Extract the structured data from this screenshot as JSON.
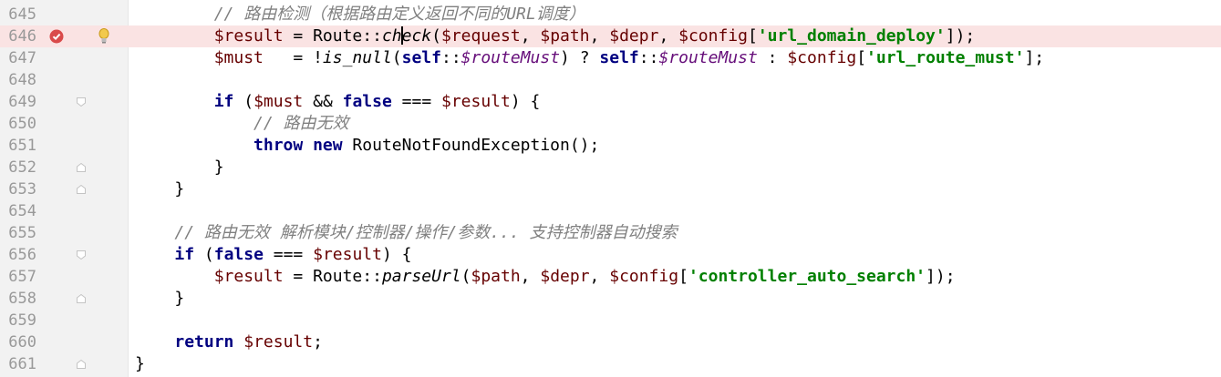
{
  "editor": {
    "lines": [
      {
        "num": "645",
        "tokens": [
          [
            "",
            "        "
          ],
          [
            "cm",
            "// 路由检测（根据路由定义返回不同的URL调度）"
          ]
        ]
      },
      {
        "num": "646",
        "breakpoint": true,
        "intention": true,
        "tokens": [
          [
            "",
            "        "
          ],
          [
            "var",
            "$result"
          ],
          [
            "",
            " = Route::"
          ],
          [
            "fn",
            "ch"
          ],
          [
            "caret",
            ""
          ],
          [
            "fn",
            "eck"
          ],
          [
            "",
            "("
          ],
          [
            "var",
            "$request"
          ],
          [
            "",
            ", "
          ],
          [
            "var",
            "$path"
          ],
          [
            "",
            ", "
          ],
          [
            "var",
            "$depr"
          ],
          [
            "",
            ", "
          ],
          [
            "var",
            "$config"
          ],
          [
            "",
            "["
          ],
          [
            "str",
            "'url_domain_deploy'"
          ],
          [
            "",
            "]);"
          ]
        ]
      },
      {
        "num": "647",
        "tokens": [
          [
            "",
            "        "
          ],
          [
            "var",
            "$must"
          ],
          [
            "",
            "   = !"
          ],
          [
            "fn",
            "is_null"
          ],
          [
            "",
            "("
          ],
          [
            "kw",
            "self"
          ],
          [
            "",
            "::"
          ],
          [
            "sv",
            "$routeMust"
          ],
          [
            "",
            ") ? "
          ],
          [
            "kw",
            "self"
          ],
          [
            "",
            "::"
          ],
          [
            "sv",
            "$routeMust"
          ],
          [
            "",
            " : "
          ],
          [
            "var",
            "$config"
          ],
          [
            "",
            "["
          ],
          [
            "str",
            "'url_route_must'"
          ],
          [
            "",
            "];"
          ]
        ]
      },
      {
        "num": "648",
        "tokens": []
      },
      {
        "num": "649",
        "fold": "open",
        "tokens": [
          [
            "",
            "        "
          ],
          [
            "kw",
            "if"
          ],
          [
            "",
            " ("
          ],
          [
            "var",
            "$must"
          ],
          [
            "",
            " && "
          ],
          [
            "kw",
            "false"
          ],
          [
            "",
            " === "
          ],
          [
            "var",
            "$result"
          ],
          [
            "",
            ") {"
          ]
        ]
      },
      {
        "num": "650",
        "tokens": [
          [
            "",
            "            "
          ],
          [
            "cm",
            "// 路由无效"
          ]
        ]
      },
      {
        "num": "651",
        "tokens": [
          [
            "",
            "            "
          ],
          [
            "kw",
            "throw new"
          ],
          [
            "",
            " RouteNotFoundException();"
          ]
        ]
      },
      {
        "num": "652",
        "fold": "close",
        "tokens": [
          [
            "",
            "        }"
          ]
        ]
      },
      {
        "num": "653",
        "fold": "close",
        "tokens": [
          [
            "",
            "    }"
          ]
        ]
      },
      {
        "num": "654",
        "tokens": []
      },
      {
        "num": "655",
        "tokens": [
          [
            "",
            "    "
          ],
          [
            "cm",
            "// 路由无效 解析模块/控制器/操作/参数... 支持控制器自动搜索"
          ]
        ]
      },
      {
        "num": "656",
        "fold": "open",
        "tokens": [
          [
            "",
            "    "
          ],
          [
            "kw",
            "if"
          ],
          [
            "",
            " ("
          ],
          [
            "kw",
            "false"
          ],
          [
            "",
            " === "
          ],
          [
            "var",
            "$result"
          ],
          [
            "",
            ") {"
          ]
        ]
      },
      {
        "num": "657",
        "tokens": [
          [
            "",
            "        "
          ],
          [
            "var",
            "$result"
          ],
          [
            "",
            " = Route::"
          ],
          [
            "fn",
            "parseUrl"
          ],
          [
            "",
            "("
          ],
          [
            "var",
            "$path"
          ],
          [
            "",
            ", "
          ],
          [
            "var",
            "$depr"
          ],
          [
            "",
            ", "
          ],
          [
            "var",
            "$config"
          ],
          [
            "",
            "["
          ],
          [
            "str",
            "'controller_auto_search'"
          ],
          [
            "",
            "]);"
          ]
        ]
      },
      {
        "num": "658",
        "fold": "close",
        "tokens": [
          [
            "",
            "    }"
          ]
        ]
      },
      {
        "num": "659",
        "tokens": []
      },
      {
        "num": "660",
        "tokens": [
          [
            "",
            "    "
          ],
          [
            "kw",
            "return"
          ],
          [
            " ",
            ""
          ],
          [
            "var",
            " $result"
          ],
          [
            "",
            ";"
          ]
        ]
      },
      {
        "num": "661",
        "fold": "close",
        "tokens": [
          [
            "",
            "}"
          ]
        ]
      }
    ]
  }
}
